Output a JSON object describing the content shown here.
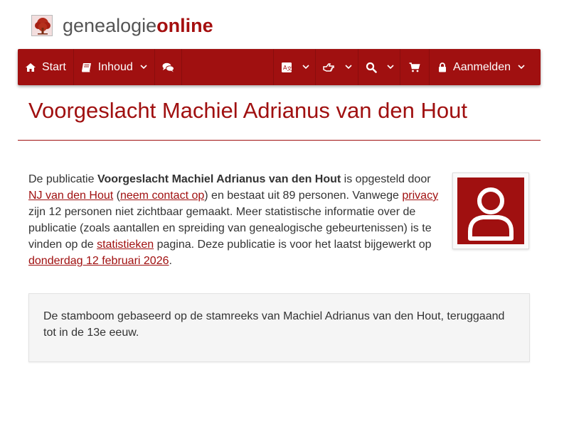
{
  "site": {
    "logo_first": "genealogie",
    "logo_second": "online"
  },
  "nav": {
    "start_label": "Start",
    "inhoud_label": "Inhoud",
    "aanmelden_label": "Aanmelden"
  },
  "page": {
    "title": "Voorgeslacht Machiel Adrianus van den Hout"
  },
  "intro": {
    "t1": "De publicatie ",
    "pub_name": "Voorgeslacht Machiel Adrianus van den Hout",
    "t2": " is opgesteld door ",
    "author_link": "NJ van den Hout",
    "t3": " (",
    "contact_link": "neem contact op",
    "t4": ") en bestaat uit 89 personen. Vanwege ",
    "privacy_link": "privacy",
    "t5": " zijn 12 personen niet zichtbaar gemaakt. Meer statistische informatie over de publicatie (zoals aantallen en spreiding van genealogische gebeurtenissen) is te vinden op de ",
    "stats_link": "statistieken",
    "t6": " pagina. Deze publicatie is voor het laatst bijgewerkt op ",
    "date_link": "donderdag 12 februari 2026",
    "t7": "."
  },
  "description": {
    "text": "De stamboom gebaseerd op de stamreeks van Machiel Adrianus van den Hout, teruggaand tot in de 13e eeuw."
  },
  "colors": {
    "brand": "#a01010",
    "text": "#333333"
  },
  "icons": [
    "tree-logo-icon",
    "home-icon",
    "book-icon",
    "comments-icon",
    "translate-icon",
    "pointer-hand-icon",
    "search-icon",
    "cart-icon",
    "lock-icon",
    "chevron-down-icon",
    "user-avatar-icon"
  ]
}
